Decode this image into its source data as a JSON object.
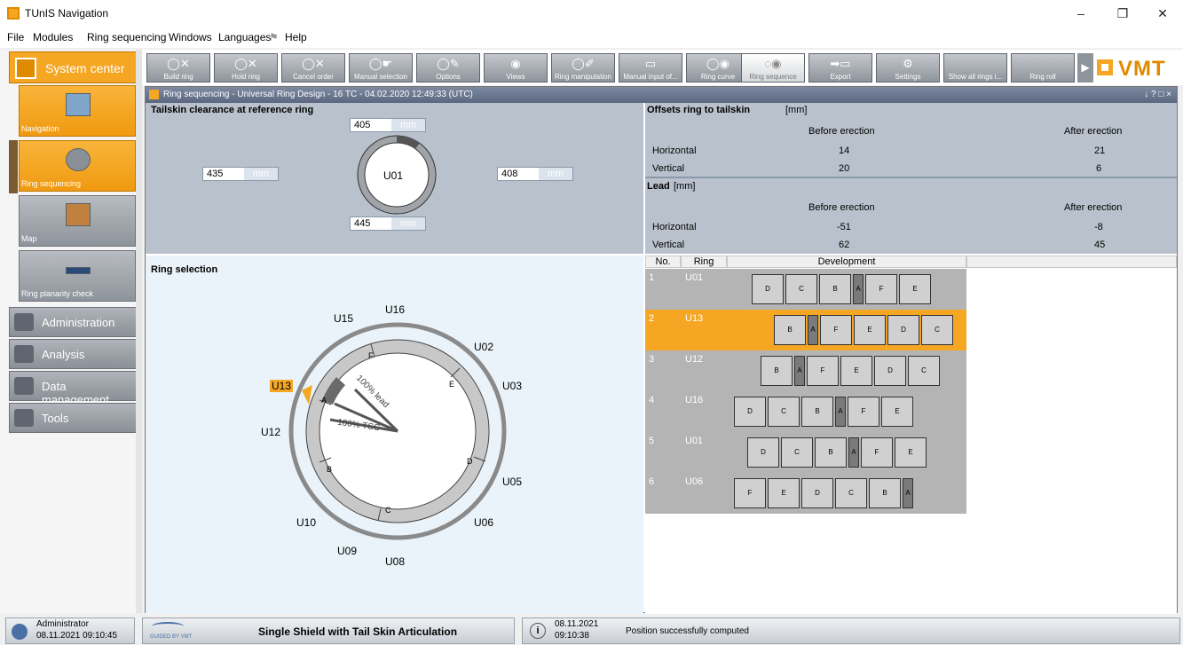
{
  "window": {
    "title": "TUnIS Navigation",
    "min": "–",
    "max": "❐",
    "close": "✕"
  },
  "menu": [
    "File",
    "Modules",
    "Ring sequencing",
    "Windows",
    "Languages",
    "Help"
  ],
  "leftnav": {
    "system_center": "System center",
    "tiles": [
      "Navigation",
      "Ring sequencing",
      "Map",
      "Ring planarity check"
    ],
    "sections": [
      "Administration",
      "Analysis",
      "Data management",
      "Tools"
    ]
  },
  "toolbar": [
    {
      "label": "Build ring",
      "icon": "ring-x-icon"
    },
    {
      "label": "Hold ring",
      "icon": "ring-x-icon"
    },
    {
      "label": "Cancel order",
      "icon": "ring-x-icon"
    },
    {
      "label": "Manual selection",
      "icon": "ring-hand-icon"
    },
    {
      "label": "Options",
      "icon": "ring-bulb-icon"
    },
    {
      "label": "Views",
      "icon": "eye-icon"
    },
    {
      "label": "Ring manipulation",
      "icon": "ring-pen-icon"
    },
    {
      "label": "Manual input of...",
      "icon": "input-icon"
    },
    {
      "label": "Ring curve",
      "icon": "ring-eye-icon"
    },
    {
      "label": "Ring sequence",
      "icon": "sequence-icon"
    },
    {
      "label": "Export",
      "icon": "export-icon"
    },
    {
      "label": "Settings",
      "icon": "settings-icon"
    },
    {
      "label": "Show all rings i...",
      "icon": ""
    },
    {
      "label": "Ring roll",
      "icon": ""
    }
  ],
  "logo": "VMT",
  "doc": {
    "title": "Ring sequencing - Universal Ring Design - 16 TC - 04.02.2020 12:49:33 (UTC)",
    "controls": "↓ ? □ ×"
  },
  "tailskin": {
    "heading": "Tailskin clearance at reference ring",
    "top": "405",
    "left": "435",
    "right": "408",
    "bottom": "445",
    "unit": "mm",
    "ring": "U01"
  },
  "offsets": {
    "heading": "Offsets ring to tailskin",
    "unit": "[mm]",
    "before": "Before erection",
    "after": "After erection",
    "rows": [
      {
        "label": "Horizontal",
        "before": "14",
        "after": "21"
      },
      {
        "label": "Vertical",
        "before": "20",
        "after": "6"
      }
    ]
  },
  "lead": {
    "heading": "Lead",
    "unit": "[mm]",
    "before": "Before erection",
    "after": "After erection",
    "rows": [
      {
        "label": "Horizontal",
        "before": "-51",
        "after": "-8"
      },
      {
        "label": "Vertical",
        "before": "62",
        "after": "45"
      }
    ]
  },
  "ring_selection": {
    "heading": "Ring selection",
    "positions": [
      "U16",
      "U02",
      "U03",
      "U05",
      "U06",
      "U08",
      "U09",
      "U10",
      "U12",
      "U13",
      "U15"
    ],
    "selected": "U13",
    "segments": [
      "F",
      "E",
      "D",
      "C",
      "B",
      "A"
    ],
    "lead_label": "100% lead",
    "tsc_label": "100% TSC"
  },
  "development": {
    "headers": [
      "No.",
      "Ring",
      "Development"
    ],
    "rows": [
      {
        "no": "1",
        "ring": "U01",
        "segs": [
          "D",
          "C",
          "B",
          "A",
          "F",
          "E"
        ]
      },
      {
        "no": "2",
        "ring": "U13",
        "segs": [
          "B",
          "A",
          "F",
          "E",
          "D",
          "C"
        ]
      },
      {
        "no": "3",
        "ring": "U12",
        "segs": [
          "B",
          "A",
          "F",
          "E",
          "D",
          "C"
        ]
      },
      {
        "no": "4",
        "ring": "U16",
        "segs": [
          "D",
          "C",
          "B",
          "A",
          "F",
          "E"
        ]
      },
      {
        "no": "5",
        "ring": "U01",
        "segs": [
          "D",
          "C",
          "B",
          "A",
          "F",
          "E"
        ]
      },
      {
        "no": "6",
        "ring": "U06",
        "segs": [
          "F",
          "E",
          "D",
          "C",
          "B",
          "A"
        ]
      }
    ]
  },
  "status": {
    "user": "Administrator",
    "user_time": "08.11.2021 09:10:45",
    "guided": "GUIDED BY VMT",
    "mode": "Single Shield with Tail Skin Articulation",
    "info_date": "08.11.2021",
    "info_time": "09:10:38",
    "message": "Position successfully computed"
  },
  "colors": {
    "accent": "#f5a623",
    "panel": "#b9c2cc",
    "title": "#5a6780"
  }
}
